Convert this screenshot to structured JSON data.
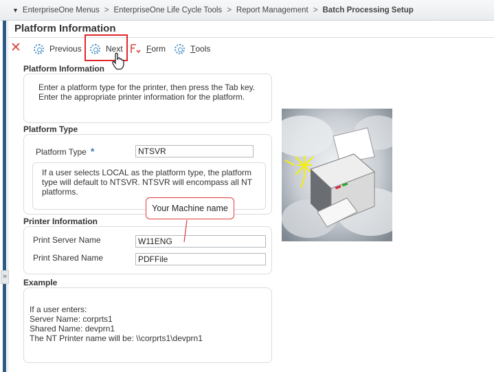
{
  "breadcrumb": {
    "items": [
      "EnterpriseOne Menus",
      "EnterpriseOne Life Cycle Tools",
      "Report Management"
    ],
    "current": "Batch Processing Setup",
    "separator": ">"
  },
  "page": {
    "title": "Platform Information"
  },
  "toolbar": {
    "previous_label": "Previous",
    "next_label": "Next",
    "form_label_first": "F",
    "form_label_rest": "orm",
    "tools_label_first": "T",
    "tools_label_rest": "ools"
  },
  "sections": {
    "platform_info": {
      "heading": "Platform Information",
      "instructions_line1": "Enter a platform type for the printer, then press the Tab key.",
      "instructions_line2": "Enter the appropriate printer information for the platform."
    },
    "platform_type": {
      "heading": "Platform Type",
      "field_label": "Platform Type",
      "required_marker": "*",
      "value": "NTSVR",
      "note_line1": "If a user selects LOCAL as the platform type, the platform",
      "note_line2": "type will default to NTSVR. NTSVR will encompass all NT",
      "note_line3": "platforms."
    },
    "printer_info": {
      "heading": "Printer Information",
      "server_label": "Print Server Name",
      "server_value": "W11ENG",
      "shared_label": "Print Shared Name",
      "shared_value": "PDFFile"
    },
    "example": {
      "heading": "Example",
      "line1": "If a user enters:",
      "line2": "Server Name: corprts1",
      "line3": "Shared Name: devprn1",
      "line4": "The NT Printer name will be: \\\\corprts1\\devprn1"
    }
  },
  "annotation": {
    "callout_text": "Your Machine name"
  },
  "colors": {
    "accent_blue": "#2d5a86",
    "highlight_red": "#e0262a",
    "gear_blue": "#4a90c6"
  }
}
